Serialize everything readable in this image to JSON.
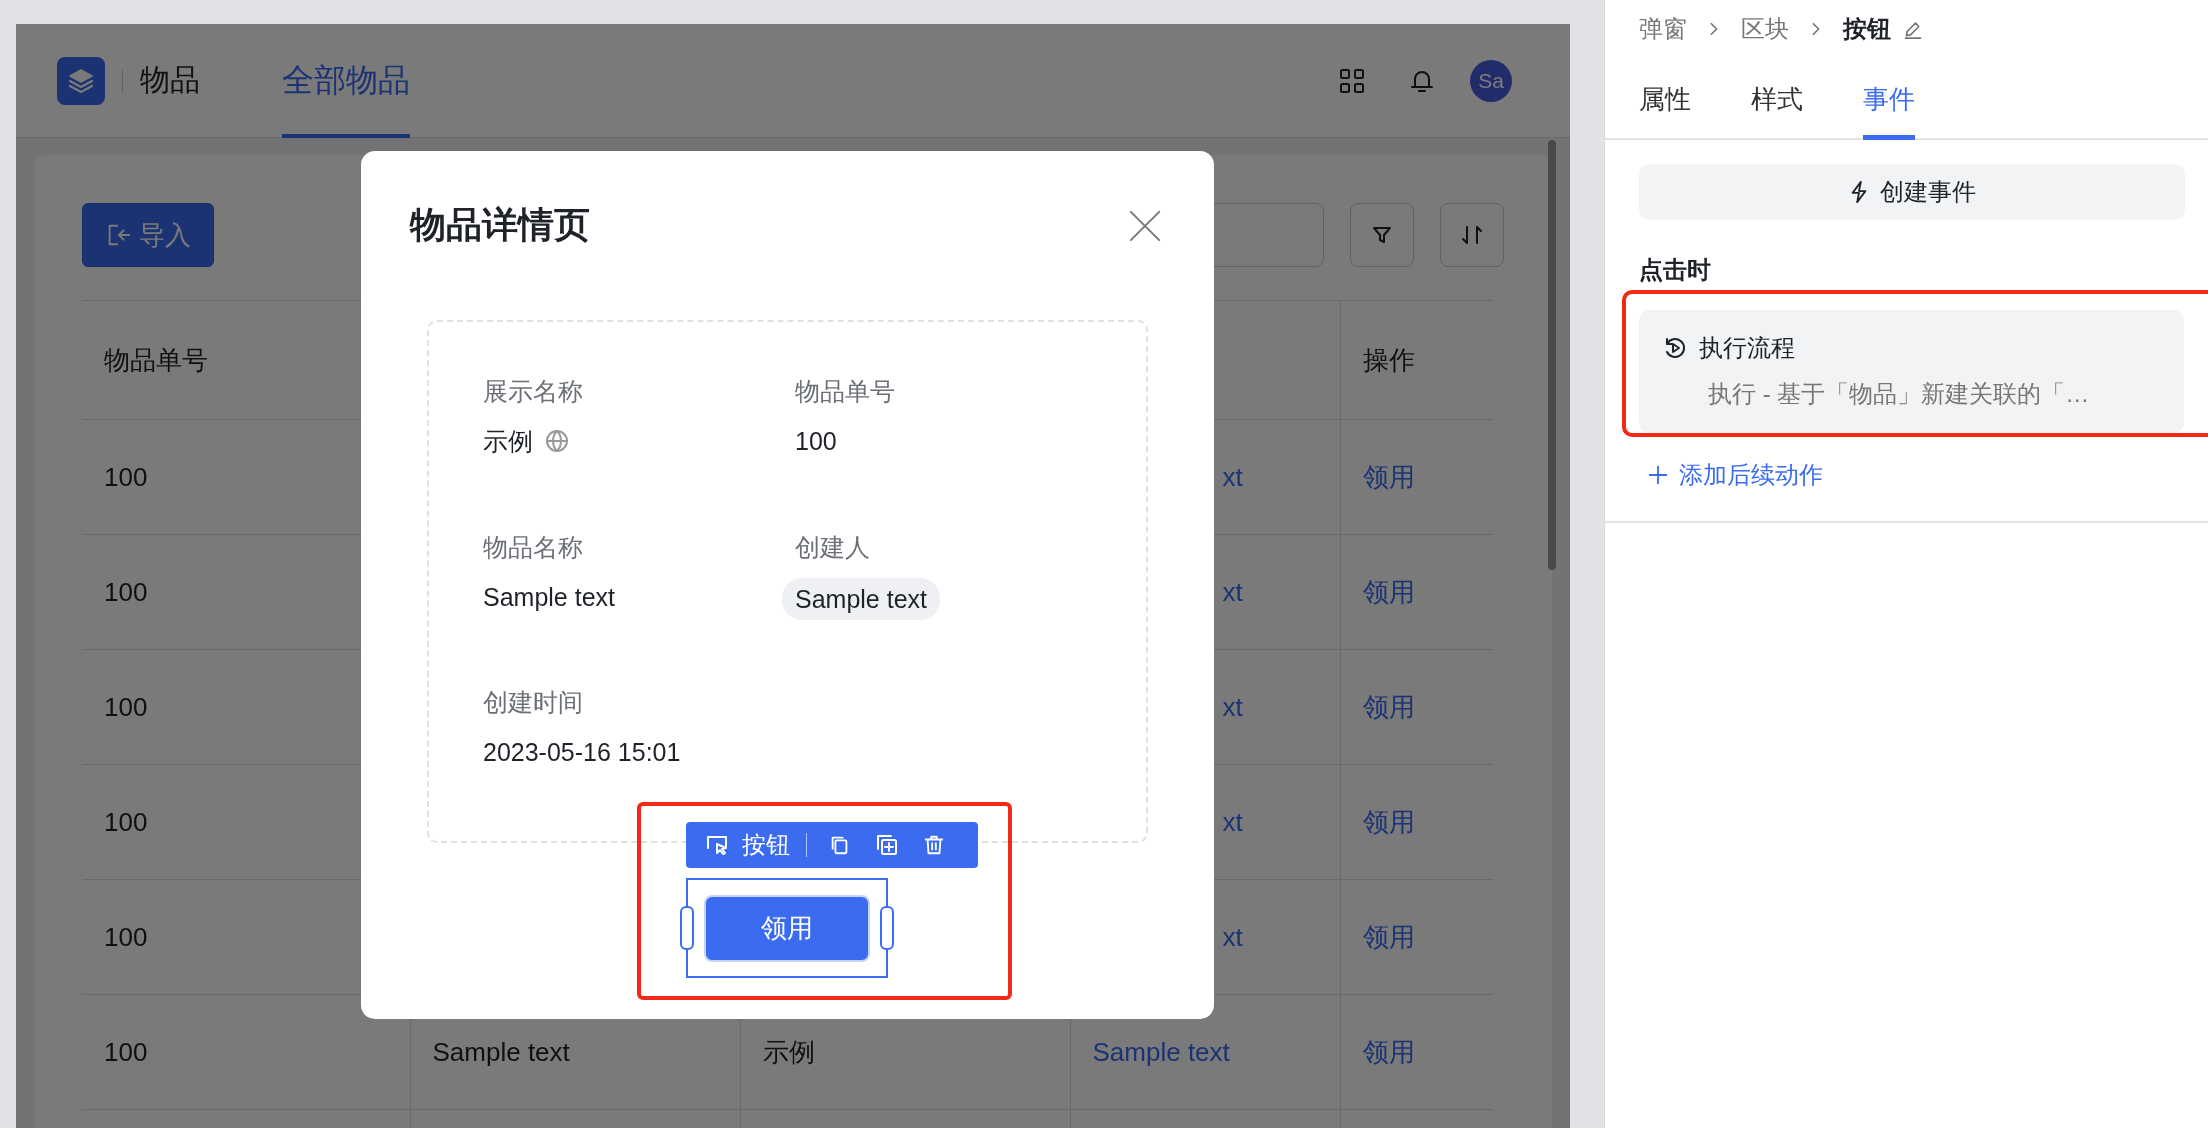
{
  "app": {
    "title": "物品",
    "tabs": [
      {
        "label": "全部物品",
        "selected": true
      }
    ],
    "avatar": "Sa"
  },
  "toolbar": {
    "import_button": "导入"
  },
  "table": {
    "columns": {
      "item_no": "物品单号",
      "action": "操作"
    },
    "rows": [
      {
        "kind": "covered",
        "item_no": "100",
        "column_4": "xt",
        "action": "领用"
      },
      {
        "kind": "covered",
        "item_no": "100",
        "column_4": "xt",
        "action": "领用"
      },
      {
        "kind": "covered",
        "item_no": "100",
        "column_4": "xt",
        "action": "领用"
      },
      {
        "kind": "covered",
        "item_no": "100",
        "column_4": "xt",
        "action": "领用"
      },
      {
        "kind": "covered",
        "item_no": "100",
        "column_4": "xt",
        "action": "领用"
      },
      {
        "kind": "full",
        "item_no": "100",
        "column_2": "Sample text",
        "column_3": "示例",
        "column_4": "Sample text",
        "action": "领用"
      }
    ]
  },
  "modal": {
    "title": "物品详情页",
    "fields": [
      {
        "kind": "translatable",
        "label": "展示名称",
        "value": "示例"
      },
      {
        "kind": "text",
        "label": "物品单号",
        "value": "100"
      },
      {
        "kind": "text",
        "label": "物品名称",
        "value": "Sample text"
      },
      {
        "kind": "user",
        "label": "创建人",
        "value": "Sample text"
      },
      {
        "kind": "text",
        "label": "创建时间",
        "value": "2023-05-16 15:01"
      }
    ],
    "selection_label": "按钮",
    "button": "领用"
  },
  "panel": {
    "breadcrumb": [
      "弹窗",
      "区块",
      "按钮"
    ],
    "tabs": [
      {
        "label": "属性",
        "selected": false
      },
      {
        "label": "样式",
        "selected": false
      },
      {
        "label": "事件",
        "selected": true
      }
    ],
    "create_event_button": "创建事件",
    "section_title": "点击时",
    "actions": [
      {
        "title": "执行流程",
        "description": "执行 - 基于「物品」新建关联的「…"
      }
    ],
    "add_action_link": "添加后续动作"
  }
}
